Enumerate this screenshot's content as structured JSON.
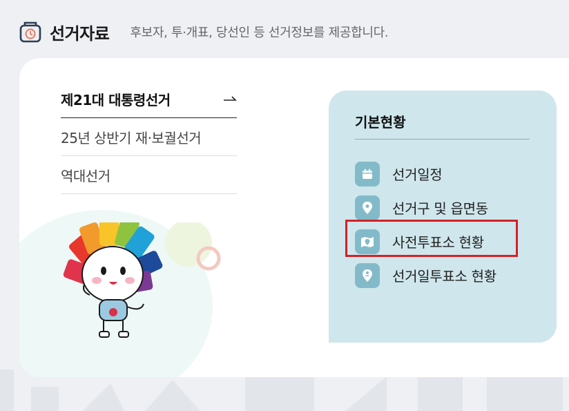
{
  "header": {
    "title": "선거자료",
    "description": "후보자, 투·개표, 당선인 등 선거정보를 제공합니다."
  },
  "elections": [
    {
      "label": "제21대 대통령선거",
      "active": true
    },
    {
      "label": "25년 상반기 재·보궐선거",
      "active": false
    },
    {
      "label": "역대선거",
      "active": false
    }
  ],
  "panel": {
    "title": "기본현황",
    "links": [
      {
        "label": "선거일정",
        "icon": "calendar-icon"
      },
      {
        "label": "선거구 및 읍면동",
        "icon": "location-pin-icon"
      },
      {
        "label": "사전투표소 현황",
        "icon": "map-pin-icon"
      },
      {
        "label": "선거일투표소 현황",
        "icon": "person-pin-icon"
      }
    ]
  },
  "colors": {
    "background": "#eef0f3",
    "panel": "#cfe6ec",
    "icon_bg": "#83bac9",
    "highlight": "#d42027"
  }
}
